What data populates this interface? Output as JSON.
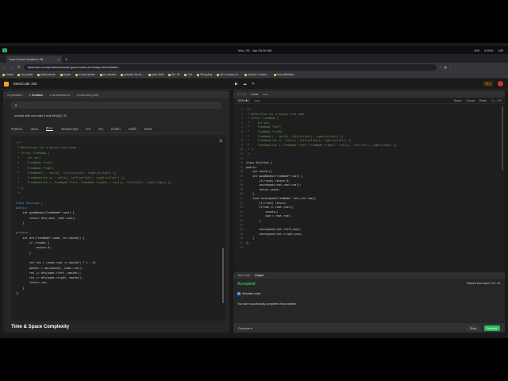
{
  "os": {
    "workspace": "2",
    "clock": "Mon, 26 . Jan 05:19 AM",
    "status": [
      "495",
      "3.09%",
      "185"
    ]
  },
  "browser": {
    "tab_title": "Count Good Nodes in Bi...",
    "tab_close": "×",
    "new_tab": "+",
    "url": "leetcode.com/problems/count-good-nodes-in-binary-tree/solution",
    "bookmarks": [
      "Gmail",
      "my portal",
      "placements",
      "books",
      "tv and anime",
      "cs classes",
      "prepare for le...",
      "work stuff",
      "ALL AI",
      "Cut",
      "Shopping",
      "ALL money st...",
      "survey / Learni...",
      "How effective..."
    ]
  },
  "leetcode": {
    "brand": "MeetCode 150",
    "center_icons": [
      "▶",
      "☁",
      "✎"
    ],
    "premium": "Pro",
    "left_tabs": [
      {
        "label": "Question"
      },
      {
        "label": "Solution",
        "active": true
      },
      {
        "label": "Submissions"
      },
      {
        "label": "Discuss (153)"
      }
    ],
    "example_value": "6",
    "example_note": "minutes with root node 6 and left (8)(2, 8).",
    "languages": [
      "Python",
      "Java",
      "C++",
      "JavaScript",
      "C#",
      "Go",
      "Kotlin",
      "Swift",
      "Rust"
    ],
    "active_language": "C++",
    "section_title": "Time & Space Complexity"
  },
  "solution_code": [
    {
      "text": "/**",
      "cls": "c-comment"
    },
    {
      "text": " * Definition for a binary tree node.",
      "cls": "c-comment"
    },
    {
      "text": " * struct TreeNode {",
      "cls": "c-comment"
    },
    {
      "text": " *     int val;",
      "cls": "c-comment"
    },
    {
      "text": " *     TreeNode *left;",
      "cls": "c-comment"
    },
    {
      "text": " *     TreeNode *right;",
      "cls": "c-comment"
    },
    {
      "text": " *     TreeNode() : val(0), left(nullptr), right(nullptr) {}",
      "cls": "c-comment"
    },
    {
      "text": " *     TreeNode(int x) : val(x), left(nullptr), right(nullptr) {}",
      "cls": "c-comment"
    },
    {
      "text": " *     TreeNode(int x, TreeNode *left, TreeNode *right) : val(x), left(left), right(right) {}",
      "cls": "c-comment"
    },
    {
      "text": " * };",
      "cls": "c-comment"
    },
    {
      "text": " */",
      "cls": "c-comment"
    },
    {
      "text": "",
      "cls": ""
    },
    {
      "text": "class Solution {",
      "cls": "c-key"
    },
    {
      "text": "public:",
      "cls": "c-key"
    },
    {
      "text": "    int goodNodes(TreeNode* root) {",
      "cls": ""
    },
    {
      "text": "        return dfs(root, root->val);",
      "cls": ""
    },
    {
      "text": "    }",
      "cls": ""
    },
    {
      "text": "",
      "cls": ""
    },
    {
      "text": "private:",
      "cls": "c-key"
    },
    {
      "text": "    int dfs(TreeNode* node, int maxVal) {",
      "cls": ""
    },
    {
      "text": "        if (!node) {",
      "cls": ""
    },
    {
      "text": "            return 0;",
      "cls": ""
    },
    {
      "text": "        }",
      "cls": ""
    },
    {
      "text": "",
      "cls": ""
    },
    {
      "text": "        int res = (node->val >= maxVal) ? 1 : 0;",
      "cls": ""
    },
    {
      "text": "        maxVal = max(maxVal, node->val);",
      "cls": ""
    },
    {
      "text": "        res += dfs(node->left, maxVal);",
      "cls": ""
    },
    {
      "text": "        res += dfs(node->right, maxVal);",
      "cls": ""
    },
    {
      "text": "        return res;",
      "cls": ""
    },
    {
      "text": "    }",
      "cls": ""
    },
    {
      "text": "};",
      "cls": ""
    }
  ],
  "editor": {
    "header": [
      "C++ ▾",
      "Code",
      "</>",
      "Auto"
    ],
    "lang_select": "C++ ▾",
    "auto_label": "Auto",
    "right_labels": [
      "Saved",
      "Format",
      "Reset",
      "1:1 - 5 R"
    ],
    "lines": [
      {
        "n": "1",
        "t": "/**"
      },
      {
        "n": "2",
        "t": " * Definition for a binary tree node."
      },
      {
        "n": "3",
        "t": " * struct TreeNode {"
      },
      {
        "n": "4",
        "t": " *     int val;"
      },
      {
        "n": "5",
        "t": " *     TreeNode *left;"
      },
      {
        "n": "6",
        "t": " *     TreeNode *right;"
      },
      {
        "n": "7",
        "t": " *     TreeNode() : val(0), left(nullptr), right(nullptr) {}"
      },
      {
        "n": "8",
        "t": " *     TreeNode(int x) : val(x), left(nullptr), right(nullptr) {}"
      },
      {
        "n": "9",
        "t": " *     TreeNode(int x, TreeNode *left, TreeNode *right) : val(x), left(left), right(right) {}"
      },
      {
        "n": "10",
        "t": " * };"
      },
      {
        "n": "11",
        "t": " */"
      },
      {
        "n": "12",
        "t": ""
      },
      {
        "n": "13",
        "t": "class Solution {"
      },
      {
        "n": "14",
        "t": "public:"
      },
      {
        "n": "15",
        "t": "    int count(){"
      },
      {
        "n": "16",
        "t": "    int goodNodes(TreeNode* root) {"
      },
      {
        "n": "17",
        "t": "        if(!root) return 0;"
      },
      {
        "n": "18",
        "t": "        countgood(root,root->val);"
      },
      {
        "n": "19",
        "t": "        return count;"
      },
      {
        "n": "20",
        "t": "    }"
      },
      {
        "n": "21",
        "t": "    void countgood(TreeNode* root,int num){"
      },
      {
        "n": "22",
        "t": "        if(!root) return;"
      },
      {
        "n": "23",
        "t": "        if(num <= root->val){"
      },
      {
        "n": "24",
        "t": "            count++;"
      },
      {
        "n": "25",
        "t": "            num = root->val;"
      },
      {
        "n": "26",
        "t": "        }"
      },
      {
        "n": "27",
        "t": ""
      },
      {
        "n": "28",
        "t": "        countgood(root->left,num);"
      },
      {
        "n": "29",
        "t": "        countgood(root->right,num);"
      },
      {
        "n": "30",
        "t": "    }"
      },
      {
        "n": "31",
        "t": "};"
      },
      {
        "n": "32",
        "t": ""
      }
    ]
  },
  "result": {
    "tabs": [
      "Test Case",
      "Output"
    ],
    "status": "Accepted",
    "passed": "Passed test cases: 24 / 24",
    "visualize": "Visualize node",
    "message": "You have successfully completed this problem!",
    "console": "Console ▾",
    "run": "Run",
    "submit": "Submit"
  }
}
